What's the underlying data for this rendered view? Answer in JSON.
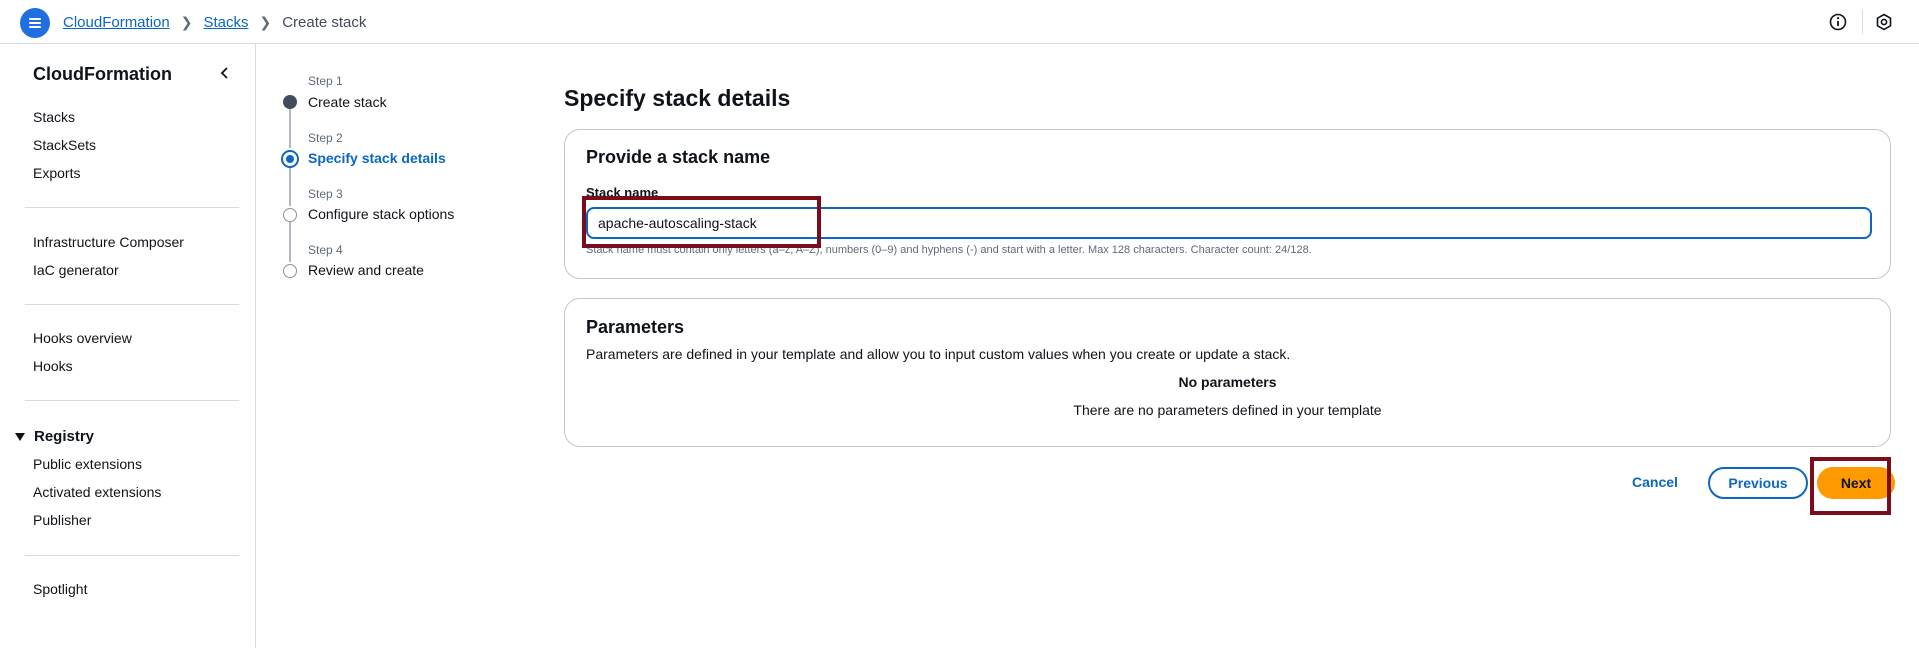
{
  "header": {
    "breadcrumb": [
      {
        "label": "CloudFormation",
        "link": true
      },
      {
        "label": "Stacks",
        "link": true
      },
      {
        "label": "Create stack",
        "link": false
      }
    ],
    "icons": [
      "menu-icon",
      "info-icon",
      "settings-icon"
    ]
  },
  "sidebar": {
    "title": "CloudFormation",
    "group1": [
      "Stacks",
      "StackSets",
      "Exports"
    ],
    "group2": [
      "Infrastructure Composer",
      "IaC generator"
    ],
    "group3": [
      "Hooks overview",
      "Hooks"
    ],
    "registry": {
      "label": "Registry",
      "items": [
        "Public extensions",
        "Activated extensions",
        "Publisher"
      ]
    },
    "group5": [
      "Spotlight"
    ]
  },
  "steps": [
    {
      "label": "Step 1",
      "title": "Create stack",
      "state": "complete"
    },
    {
      "label": "Step 2",
      "title": "Specify stack details",
      "state": "current"
    },
    {
      "label": "Step 3",
      "title": "Configure stack options",
      "state": "pending"
    },
    {
      "label": "Step 4",
      "title": "Review and create",
      "state": "pending"
    }
  ],
  "main": {
    "page_title": "Specify stack details",
    "stack_name_card": {
      "title": "Provide a stack name",
      "field_label": "Stack name",
      "value": "apache-autoscaling-stack",
      "constraint": "Stack name must contain only letters (a–z, A–Z), numbers (0–9) and hyphens (-) and start with a letter. Max 128 characters. Character count: 24/128."
    },
    "parameters_card": {
      "title": "Parameters",
      "description": "Parameters are defined in your template and allow you to input custom values when you create or update a stack.",
      "empty_title": "No parameters",
      "empty_text": "There are no parameters defined in your template"
    }
  },
  "footer": {
    "cancel_label": "Cancel",
    "previous_label": "Previous",
    "next_label": "Next"
  },
  "colors": {
    "accent": "#0b67c4",
    "primary_button": "#ff9900",
    "highlight_box": "#7a0d1c"
  }
}
